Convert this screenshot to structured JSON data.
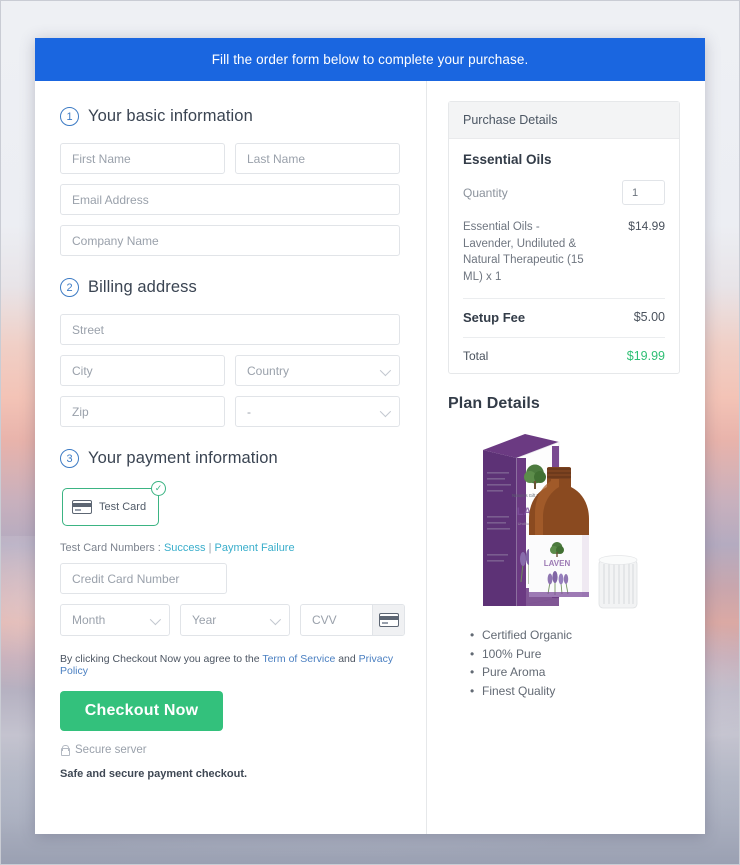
{
  "banner": {
    "text": "Fill the order form below to complete your purchase."
  },
  "steps": {
    "one": {
      "num": "1",
      "title": "Your basic information"
    },
    "two": {
      "num": "2",
      "title": "Billing address"
    },
    "three": {
      "num": "3",
      "title": "Your payment information"
    }
  },
  "basic": {
    "first_name_placeholder": "First Name",
    "last_name_placeholder": "Last Name",
    "email_placeholder": "Email Address",
    "company_placeholder": "Company Name"
  },
  "billing": {
    "street_placeholder": "Street",
    "city_placeholder": "City",
    "country_placeholder": "Country",
    "zip_placeholder": "Zip",
    "state_placeholder": "-"
  },
  "payment": {
    "method_label": "Test Card",
    "method_selected": true,
    "check_glyph": "✓",
    "test_numbers_label": "Test Card Numbers :",
    "success_link": "Success",
    "separator": "|",
    "failure_link": "Payment Failure",
    "card_number_placeholder": "Credit Card Number",
    "month_placeholder": "Month",
    "year_placeholder": "Year",
    "cvv_placeholder": "CVV"
  },
  "legal": {
    "prefix": "By clicking Checkout Now you agree to the",
    "terms_link": "Term of Service",
    "conjunction": "and",
    "privacy_link": "Privacy Policy"
  },
  "actions": {
    "checkout_label": "Checkout Now",
    "secure_label": "Secure server",
    "safe_note": "Safe and secure payment checkout."
  },
  "purchase": {
    "header": "Purchase Details",
    "product_name": "Essential Oils",
    "quantity_label": "Quantity",
    "quantity_value": "1",
    "line_item_desc": "Essential Oils - Lavender, Undiluted & Natural Therapeutic (15 ML) x 1",
    "line_item_price": "$14.99",
    "setup_fee_label": "Setup Fee",
    "setup_fee_value": "$5.00",
    "total_label": "Total",
    "total_value": "$19.99"
  },
  "plan": {
    "title": "Plan Details",
    "features": [
      "Certified Organic",
      "100% Pure",
      "Pure Aroma",
      "Finest Quality"
    ]
  },
  "colors": {
    "banner_blue": "#1a66e0",
    "checkout_green": "#33c17c",
    "total_green": "#2fbf74",
    "step_blue": "#3d7bc4",
    "link_blue": "#4a7fc1",
    "link_teal": "#3aaecb"
  }
}
